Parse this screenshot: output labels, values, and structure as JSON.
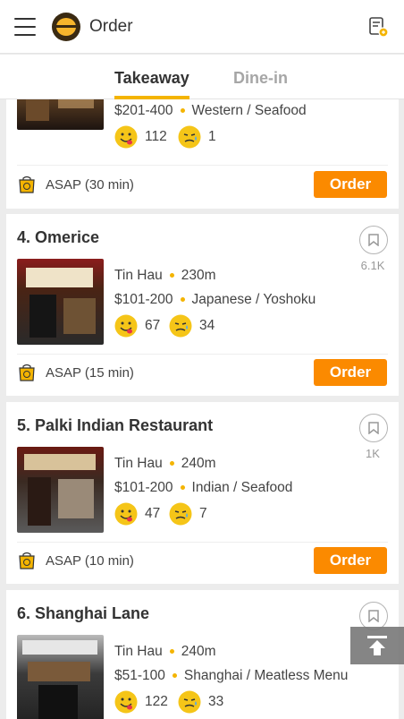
{
  "header": {
    "title": "Order"
  },
  "tabs": [
    {
      "label": "Takeaway"
    },
    {
      "label": "Dine-in"
    }
  ],
  "colors": {
    "accent": "#f4b400",
    "order_button": "#fb8a00"
  },
  "icons": [
    "menu-icon",
    "app-logo",
    "order-history-icon",
    "bookmark-icon",
    "smile-icon",
    "sad-icon",
    "takeaway-bag-icon",
    "back-to-top-icon"
  ],
  "restaurants": [
    {
      "price": "$201-400",
      "cuisine": "Western / Seafood",
      "likes": "112",
      "dislikes": "1",
      "takeaway_time": "ASAP (30 min)",
      "order_label": "Order"
    },
    {
      "name": "4.  Omerice",
      "bookmarks": "6.1K",
      "district": "Tin Hau",
      "distance": "230m",
      "price": "$101-200",
      "cuisine": "Japanese / Yoshoku",
      "likes": "67",
      "dislikes": "34",
      "takeaway_time": "ASAP (15 min)",
      "order_label": "Order"
    },
    {
      "name": "5.  Palki Indian Restaurant",
      "bookmarks": "1K",
      "district": "Tin Hau",
      "distance": "240m",
      "price": "$101-200",
      "cuisine": "Indian / Seafood",
      "likes": "47",
      "dislikes": "7",
      "takeaway_time": "ASAP (10 min)",
      "order_label": "Order"
    },
    {
      "name": "6.  Shanghai Lane",
      "district": "Tin Hau",
      "distance": "240m",
      "price": "$51-100",
      "cuisine": "Shanghai / Meatless Menu",
      "likes": "122",
      "dislikes": "33"
    }
  ]
}
